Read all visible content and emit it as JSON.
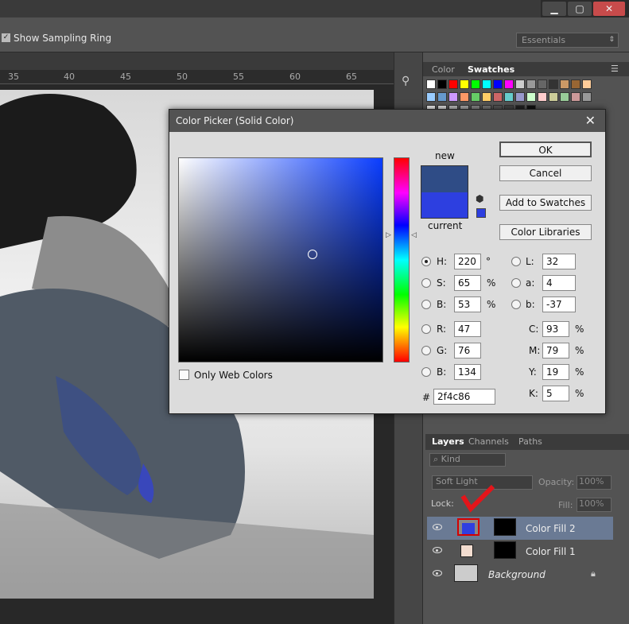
{
  "window": {
    "minimize": "▁",
    "maximize": "▢",
    "close": "✕"
  },
  "options_bar": {
    "sampling_ring_label": "Show Sampling Ring",
    "sampling_ring_checked": true,
    "workspace": "Essentials"
  },
  "ruler": {
    "ticks": [
      "35",
      "40",
      "45",
      "50",
      "55",
      "60",
      "65"
    ]
  },
  "color_panel": {
    "tabs": [
      "Color",
      "Swatches"
    ],
    "active_tab": "Swatches"
  },
  "layers_panel": {
    "tabs": [
      "Layers",
      "Channels",
      "Paths"
    ],
    "filter": "Kind",
    "blend_mode": "Soft Light",
    "opacity_label": "Opacity:",
    "opacity": "100%",
    "lock_label": "Lock:",
    "fill_label": "Fill:",
    "fill": "100%",
    "layers": [
      {
        "name": "Color Fill 2",
        "color": "#2f3fe0",
        "selected": true
      },
      {
        "name": "Color Fill 1",
        "color": "#f3ddd0",
        "selected": false
      },
      {
        "name": "Background",
        "italic": true,
        "locked": true
      }
    ]
  },
  "dialog": {
    "title": "Color Picker (Solid Color)",
    "new_label": "new",
    "current_label": "current",
    "new_color": "#2f4c86",
    "current_color": "#2d3fe0",
    "buttons": {
      "ok": "OK",
      "cancel": "Cancel",
      "add_swatches": "Add to Swatches",
      "libraries": "Color Libraries"
    },
    "only_web_colors": "Only Web Colors",
    "fields": {
      "H": {
        "value": "220",
        "unit": "°"
      },
      "S": {
        "value": "65",
        "unit": "%"
      },
      "B": {
        "value": "53",
        "unit": "%"
      },
      "R": {
        "value": "47"
      },
      "G": {
        "value": "76"
      },
      "Bv": {
        "value": "134"
      },
      "L": {
        "value": "32"
      },
      "a": {
        "value": "4"
      },
      "b": {
        "value": "-37"
      },
      "C": {
        "value": "93",
        "unit": "%"
      },
      "M": {
        "value": "79",
        "unit": "%"
      },
      "Y": {
        "value": "19",
        "unit": "%"
      },
      "K": {
        "value": "5",
        "unit": "%"
      }
    },
    "hex_label": "#",
    "hex": "2f4c86"
  }
}
